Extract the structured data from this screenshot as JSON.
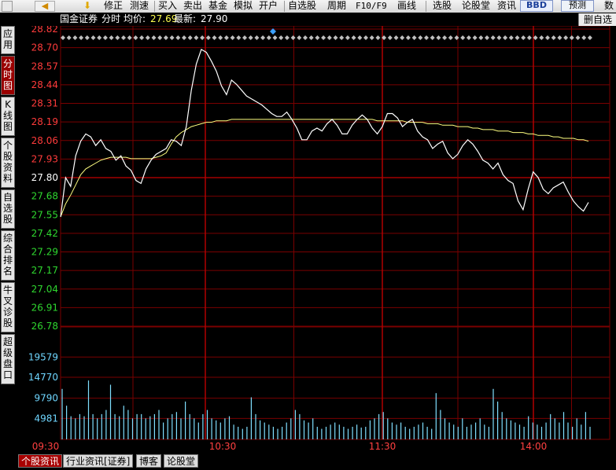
{
  "toolbar": {
    "items": [
      "修正",
      "测速",
      "买入",
      "卖出",
      "基金",
      "模拟",
      "开户",
      "自选股",
      "周期",
      "F10/F9",
      "画线",
      "选股",
      "论股堂",
      "资讯",
      "BBD",
      "预测",
      "数"
    ]
  },
  "sidebar": {
    "tabs": [
      "应用",
      "分时图",
      "K线图",
      "个股资料",
      "自选股",
      "综合排名",
      "牛叉诊股",
      "超级盘口"
    ]
  },
  "header": {
    "stock_name": "国金证券",
    "view": "分时",
    "avg_label": "均价:",
    "avg_value": "27.69",
    "last_label": "最新:",
    "last_value": "27.90",
    "watchlist_button": "删自选"
  },
  "bottom_tabs": [
    "个股资讯",
    "行业资讯[证券]",
    "博客",
    "论股堂"
  ],
  "colors": {
    "price_up": "#ff3b3b",
    "price_down": "#2fd72f",
    "grid": "#7a0000",
    "price_line": "#ffffff",
    "avg_line": "#ffff80",
    "volume": "#7fdfff"
  },
  "chart_data": {
    "type": "line",
    "title": "国金证券 分时",
    "prev_close": 27.8,
    "price_ticks": [
      "28.82",
      "28.70",
      "28.57",
      "28.44",
      "28.31",
      "28.19",
      "28.06",
      "27.93",
      "27.80",
      "27.68",
      "27.55",
      "27.42",
      "27.29",
      "27.17",
      "27.04",
      "26.91",
      "26.78"
    ],
    "volume_ticks": [
      "19579",
      "14770",
      "9790",
      "4981"
    ],
    "time_ticks": [
      "09:30",
      "10:30",
      "11:30",
      "14:00"
    ],
    "price_ylim": [
      26.78,
      28.82
    ],
    "volume_ylim": [
      0,
      24500
    ],
    "price": [
      27.53,
      27.8,
      27.74,
      27.95,
      28.05,
      28.1,
      28.08,
      28.02,
      28.06,
      28.0,
      27.98,
      27.92,
      27.95,
      27.88,
      27.85,
      27.78,
      27.76,
      27.86,
      27.92,
      27.96,
      27.98,
      28.0,
      28.06,
      28.05,
      28.02,
      28.15,
      28.4,
      28.58,
      28.68,
      28.66,
      28.6,
      28.53,
      28.43,
      28.37,
      28.47,
      28.44,
      28.4,
      28.36,
      28.34,
      28.32,
      28.3,
      28.27,
      28.24,
      28.22,
      28.22,
      28.25,
      28.2,
      28.14,
      28.06,
      28.06,
      28.12,
      28.14,
      28.12,
      28.17,
      28.2,
      28.16,
      28.1,
      28.1,
      28.16,
      28.2,
      28.23,
      28.2,
      28.14,
      28.1,
      28.15,
      28.24,
      28.24,
      28.21,
      28.15,
      28.18,
      28.2,
      28.12,
      28.08,
      28.06,
      28.0,
      28.03,
      28.05,
      27.97,
      27.93,
      27.96,
      28.02,
      28.06,
      28.03,
      27.98,
      27.92,
      27.9,
      27.86,
      27.9,
      27.82,
      27.78,
      27.76,
      27.64,
      27.58,
      27.72,
      27.84,
      27.8,
      27.72,
      27.69,
      27.73,
      27.75,
      27.77,
      27.7,
      27.64,
      27.6,
      27.57,
      27.63
    ],
    "avg_price": [
      27.53,
      27.62,
      27.68,
      27.75,
      27.82,
      27.86,
      27.88,
      27.9,
      27.92,
      27.93,
      27.94,
      27.94,
      27.94,
      27.94,
      27.93,
      27.93,
      27.93,
      27.93,
      27.93,
      27.94,
      27.95,
      27.97,
      28.03,
      28.08,
      28.11,
      28.13,
      28.15,
      28.16,
      28.17,
      28.18,
      28.18,
      28.19,
      28.19,
      28.19,
      28.2,
      28.2,
      28.2,
      28.2,
      28.2,
      28.2,
      28.2,
      28.2,
      28.2,
      28.2,
      28.2,
      28.2,
      28.2,
      28.2,
      28.2,
      28.2,
      28.2,
      28.2,
      28.2,
      28.2,
      28.2,
      28.2,
      28.2,
      28.2,
      28.2,
      28.2,
      28.2,
      28.2,
      28.2,
      28.19,
      28.19,
      28.19,
      28.19,
      28.19,
      28.19,
      28.18,
      28.18,
      28.18,
      28.18,
      28.17,
      28.17,
      28.17,
      28.16,
      28.16,
      28.16,
      28.15,
      28.15,
      28.15,
      28.14,
      28.14,
      28.13,
      28.13,
      28.13,
      28.12,
      28.12,
      28.12,
      28.11,
      28.11,
      28.11,
      28.1,
      28.1,
      28.09,
      28.09,
      28.09,
      28.08,
      28.08,
      28.07,
      28.07,
      28.07,
      28.06,
      28.06,
      28.05
    ],
    "volume": [
      12000,
      8000,
      5500,
      5000,
      6000,
      5500,
      14000,
      6000,
      5000,
      6000,
      7000,
      13000,
      6000,
      5500,
      8000,
      7000,
      5000,
      6000,
      6000,
      5000,
      5500,
      6000,
      7000,
      4000,
      5000,
      6000,
      6500,
      5000,
      9000,
      6000,
      5000,
      4000,
      6000,
      7000,
      5000,
      4500,
      4000,
      5000,
      5500,
      3500,
      3000,
      2500,
      3000,
      10000,
      6000,
      4500,
      4000,
      3500,
      3000,
      2500,
      3000,
      4000,
      5000,
      7000,
      6000,
      4500,
      4000,
      5000,
      3000,
      2500,
      3000,
      3500,
      4000,
      3500,
      3000,
      2500,
      3000,
      3500,
      2800,
      3000,
      4500,
      5000,
      6000,
      6500,
      5000,
      4000,
      3500,
      4000,
      3000,
      2500,
      3000,
      3500,
      4000,
      3000,
      2500,
      11000,
      7000,
      5000,
      4000,
      3500,
      3000,
      5000,
      3000,
      3500,
      4000,
      5000,
      3500,
      3000,
      12000,
      9000,
      6500,
      5000,
      4500,
      4000,
      3500,
      3000,
      5500,
      4000,
      3500,
      3000,
      4000,
      6000,
      5000,
      4000,
      6500,
      4000,
      3000,
      5000,
      3500,
      6500,
      3000
    ]
  }
}
